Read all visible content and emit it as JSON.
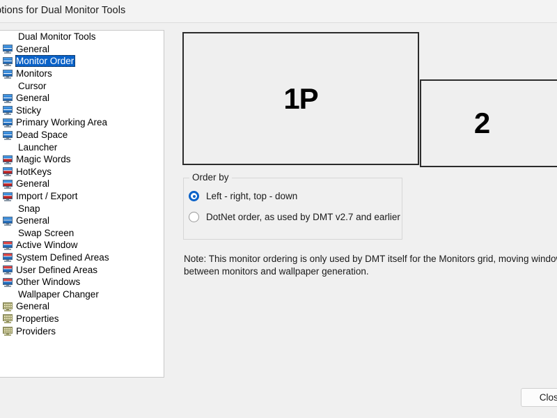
{
  "window": {
    "title": "ptions for Dual Monitor Tools"
  },
  "tree": {
    "items": [
      {
        "label": "Dual Monitor Tools",
        "icon": "none",
        "type": "group",
        "selected": false
      },
      {
        "label": "General",
        "icon": "monitor-blue-icon",
        "type": "child",
        "selected": false
      },
      {
        "label": "Monitor Order",
        "icon": "monitor-blue-icon",
        "type": "child",
        "selected": true
      },
      {
        "label": "Monitors",
        "icon": "monitor-blue-icon",
        "type": "child",
        "selected": false
      },
      {
        "label": "Cursor",
        "icon": "none",
        "type": "group",
        "selected": false
      },
      {
        "label": "General",
        "icon": "monitor-blue-icon",
        "type": "child",
        "selected": false
      },
      {
        "label": "Sticky",
        "icon": "monitor-blue-icon",
        "type": "child",
        "selected": false
      },
      {
        "label": "Primary Working Area",
        "icon": "monitor-blue-icon",
        "type": "child",
        "selected": false
      },
      {
        "label": "Dead Space",
        "icon": "monitor-blue-icon",
        "type": "child",
        "selected": false
      },
      {
        "label": "Launcher",
        "icon": "none",
        "type": "group",
        "selected": false
      },
      {
        "label": "Magic Words",
        "icon": "monitor-launcher-icon",
        "type": "child",
        "selected": false
      },
      {
        "label": "HotKeys",
        "icon": "monitor-launcher-icon",
        "type": "child",
        "selected": false
      },
      {
        "label": "General",
        "icon": "monitor-launcher-icon",
        "type": "child",
        "selected": false
      },
      {
        "label": "Import / Export",
        "icon": "monitor-launcher-icon",
        "type": "child",
        "selected": false
      },
      {
        "label": "Snap",
        "icon": "none",
        "type": "group",
        "selected": false
      },
      {
        "label": "General",
        "icon": "monitor-snap-icon",
        "type": "child",
        "selected": false
      },
      {
        "label": "Swap Screen",
        "icon": "none",
        "type": "group",
        "selected": false
      },
      {
        "label": "Active Window",
        "icon": "monitor-swap-icon",
        "type": "child",
        "selected": false
      },
      {
        "label": "System Defined Areas",
        "icon": "monitor-swap-icon",
        "type": "child",
        "selected": false
      },
      {
        "label": "User Defined Areas",
        "icon": "monitor-swap-icon",
        "type": "child",
        "selected": false
      },
      {
        "label": "Other Windows",
        "icon": "monitor-swap-icon",
        "type": "child",
        "selected": false
      },
      {
        "label": "Wallpaper Changer",
        "icon": "none",
        "type": "group",
        "selected": false
      },
      {
        "label": "General",
        "icon": "monitor-wallpaper-icon",
        "type": "child",
        "selected": false
      },
      {
        "label": "Properties",
        "icon": "monitor-wallpaper-icon",
        "type": "child",
        "selected": false
      },
      {
        "label": "Providers",
        "icon": "monitor-wallpaper-icon",
        "type": "child",
        "selected": false
      }
    ]
  },
  "preview": {
    "monitors": [
      {
        "label": "1P"
      },
      {
        "label": "2"
      }
    ]
  },
  "orderby": {
    "legend": "Order by",
    "options": [
      {
        "label": "Left - right, top - down",
        "selected": true
      },
      {
        "label": "DotNet order, as used by DMT v2.7 and earlier",
        "selected": false
      }
    ]
  },
  "note": {
    "text": "Note: This monitor ordering is only used by DMT itself for the Monitors grid, moving windows between monitors and wallpaper generation."
  },
  "footer": {
    "close_label": "Close"
  },
  "colors": {
    "accent": "#0a62c8",
    "selection": "#0a62c8",
    "window_background": "#f0f0f0",
    "panel_background": "#ffffff",
    "monitor_border": "#2b2b2b"
  }
}
